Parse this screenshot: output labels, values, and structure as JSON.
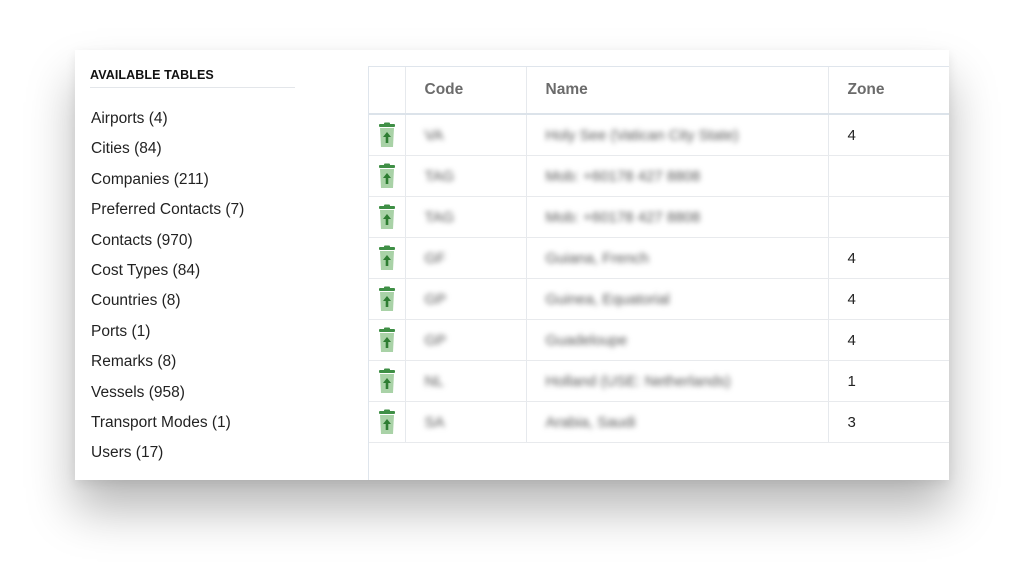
{
  "sidebar": {
    "title": "AVAILABLE TABLES",
    "items": [
      {
        "label": "Airports (4)"
      },
      {
        "label": "Cities (84)"
      },
      {
        "label": "Companies (211)"
      },
      {
        "label": "Preferred Contacts (7)"
      },
      {
        "label": "Contacts (970)"
      },
      {
        "label": "Cost Types (84)"
      },
      {
        "label": "Countries (8)"
      },
      {
        "label": "Ports (1)"
      },
      {
        "label": "Remarks (8)"
      },
      {
        "label": "Vessels (958)"
      },
      {
        "label": "Transport Modes (1)"
      },
      {
        "label": "Users (17)"
      }
    ]
  },
  "table": {
    "columns": [
      "",
      "Code",
      "Name",
      "Zone"
    ],
    "action_icon": "restore-trash-icon",
    "accent_color": "#2e7d32",
    "rows": [
      {
        "code": "VA",
        "name": "Holy See (Vatican City State)",
        "zone": "4"
      },
      {
        "code": "TAG",
        "name": "Mob: +60178 427 8808",
        "zone": ""
      },
      {
        "code": "TAG",
        "name": "Mob: +60178 427 8808",
        "zone": ""
      },
      {
        "code": "GF",
        "name": "Guiana, French",
        "zone": "4"
      },
      {
        "code": "GP",
        "name": "Guinea, Equatorial",
        "zone": "4"
      },
      {
        "code": "GP",
        "name": "Guadeloupe",
        "zone": "4"
      },
      {
        "code": "NL",
        "name": "Holland (USE: Netherlands)",
        "zone": "1"
      },
      {
        "code": "SA",
        "name": "Arabia, Saudi",
        "zone": "3"
      }
    ]
  }
}
